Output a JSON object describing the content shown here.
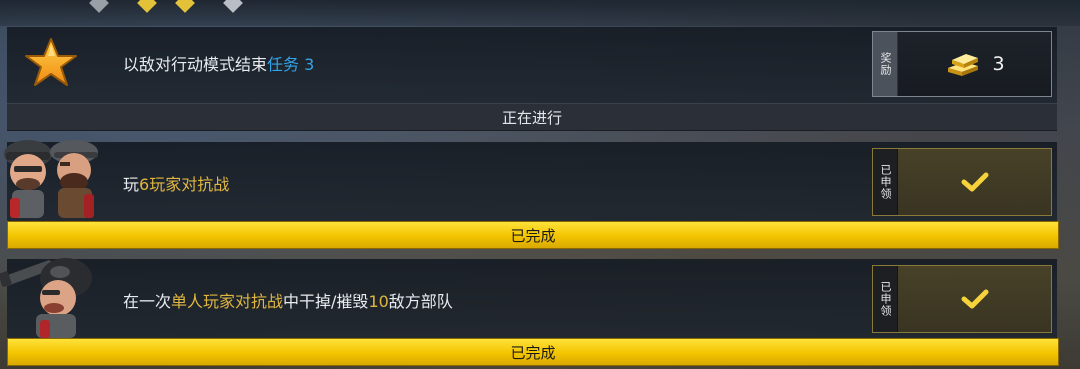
{
  "missions": [
    {
      "text_parts": [
        "以敌对行动模式结束",
        "任务 3"
      ],
      "status_label": "正在进行",
      "reward_tag": "奖励",
      "reward_icon": "gold-bars-icon",
      "reward_amount": "3",
      "state": "in-progress"
    },
    {
      "text_parts": [
        "玩",
        "6",
        "玩家对抗战"
      ],
      "status_label": "已完成",
      "reward_tag": "已申领",
      "reward_icon": "checkmark-icon",
      "state": "completed"
    },
    {
      "text_parts": [
        "在一次",
        "单人玩家对抗战",
        "中干掉/摧毁",
        "10",
        "敌方部队"
      ],
      "status_label": "已完成",
      "reward_tag": "已申领",
      "reward_icon": "checkmark-icon",
      "state": "completed"
    }
  ],
  "colors": {
    "highlight_blue": "#34a4e8",
    "highlight_gold": "#e0b640",
    "done_bar": "#f3c400",
    "progress_bar": "#2b3038"
  }
}
